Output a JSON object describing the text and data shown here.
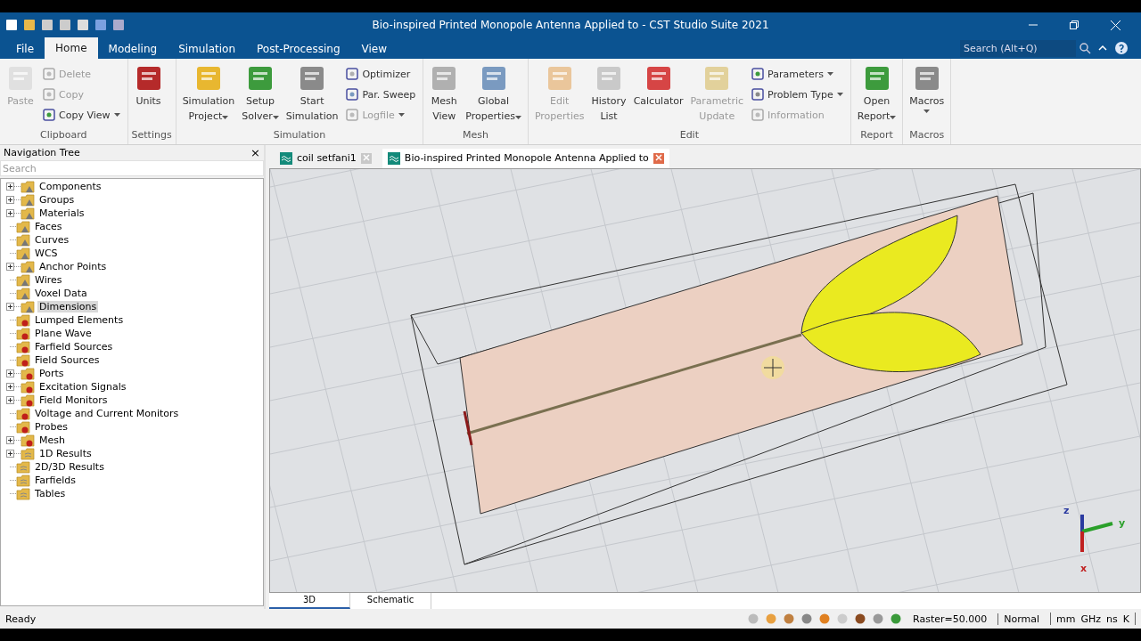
{
  "window": {
    "title": "Bio-inspired Printed Monopole Antenna Applied to - CST Studio Suite 2021"
  },
  "menu_tabs": [
    {
      "label": "File",
      "selected": false
    },
    {
      "label": "Home",
      "selected": true
    },
    {
      "label": "Modeling",
      "selected": false
    },
    {
      "label": "Simulation",
      "selected": false
    },
    {
      "label": "Post-Processing",
      "selected": false
    },
    {
      "label": "View",
      "selected": false
    }
  ],
  "search": {
    "placeholder": "Search (Alt+Q)"
  },
  "ribbon": [
    {
      "label": "Clipboard",
      "items": [
        {
          "kind": "large",
          "lines": [
            "Paste"
          ],
          "disabled": true,
          "dropdown": false
        },
        {
          "kind": "stack",
          "entries": [
            {
              "label": "Delete",
              "disabled": true,
              "dropdown": false
            },
            {
              "label": "Copy",
              "disabled": true,
              "dropdown": false
            },
            {
              "label": "Copy View",
              "disabled": false,
              "dropdown": true
            }
          ]
        }
      ]
    },
    {
      "label": "Settings",
      "items": [
        {
          "kind": "large",
          "lines": [
            "Units"
          ],
          "disabled": false,
          "dropdown": false
        }
      ]
    },
    {
      "label": "Simulation",
      "items": [
        {
          "kind": "large",
          "lines": [
            "Simulation",
            "Project"
          ],
          "disabled": false,
          "dropdown": true
        },
        {
          "kind": "large",
          "lines": [
            "Setup",
            "Solver"
          ],
          "disabled": false,
          "dropdown": true
        },
        {
          "kind": "large",
          "lines": [
            "Start",
            "Simulation"
          ],
          "disabled": false,
          "dropdown": false
        },
        {
          "kind": "stack",
          "entries": [
            {
              "label": "Optimizer",
              "disabled": false,
              "dropdown": false
            },
            {
              "label": "Par. Sweep",
              "disabled": false,
              "dropdown": false
            },
            {
              "label": "Logfile",
              "disabled": true,
              "dropdown": true
            }
          ]
        }
      ]
    },
    {
      "label": "Mesh",
      "items": [
        {
          "kind": "large",
          "lines": [
            "Mesh",
            "View"
          ],
          "disabled": false,
          "dropdown": false
        },
        {
          "kind": "large",
          "lines": [
            "Global",
            "Properties"
          ],
          "disabled": false,
          "dropdown": true
        }
      ]
    },
    {
      "label": "Edit",
      "items": [
        {
          "kind": "large",
          "lines": [
            "Edit",
            "Properties"
          ],
          "disabled": true,
          "dropdown": false
        },
        {
          "kind": "large",
          "lines": [
            "History",
            "List"
          ],
          "disabled": false,
          "dropdown": false
        },
        {
          "kind": "large",
          "lines": [
            "Calculator"
          ],
          "disabled": false,
          "dropdown": false
        },
        {
          "kind": "large",
          "lines": [
            "Parametric",
            "Update"
          ],
          "disabled": true,
          "dropdown": false
        },
        {
          "kind": "stack",
          "entries": [
            {
              "label": "Parameters",
              "disabled": false,
              "dropdown": true
            },
            {
              "label": "Problem Type",
              "disabled": false,
              "dropdown": true
            },
            {
              "label": "Information",
              "disabled": true,
              "dropdown": false
            }
          ]
        }
      ]
    },
    {
      "label": "Report",
      "items": [
        {
          "kind": "large",
          "lines": [
            "Open",
            "Report"
          ],
          "disabled": false,
          "dropdown": true
        }
      ]
    },
    {
      "label": "Macros",
      "items": [
        {
          "kind": "large",
          "lines": [
            "Macros"
          ],
          "disabled": false,
          "dropdown": true
        }
      ]
    }
  ],
  "navigation_tree": {
    "title": "Navigation Tree",
    "close": "×",
    "search": {
      "placeholder": "Search"
    },
    "items": [
      {
        "label": "Components",
        "kind": "folder",
        "expandable": true,
        "selected": false
      },
      {
        "label": "Groups",
        "kind": "folder",
        "expandable": true,
        "selected": false
      },
      {
        "label": "Materials",
        "kind": "folder",
        "expandable": true,
        "selected": false
      },
      {
        "label": "Faces",
        "kind": "folder",
        "expandable": false,
        "selected": false
      },
      {
        "label": "Curves",
        "kind": "folder",
        "expandable": false,
        "selected": false
      },
      {
        "label": "WCS",
        "kind": "folder",
        "expandable": false,
        "selected": false
      },
      {
        "label": "Anchor Points",
        "kind": "folder",
        "expandable": true,
        "selected": false
      },
      {
        "label": "Wires",
        "kind": "folder",
        "expandable": false,
        "selected": false
      },
      {
        "label": "Voxel Data",
        "kind": "folder",
        "expandable": false,
        "selected": false
      },
      {
        "label": "Dimensions",
        "kind": "folder",
        "expandable": true,
        "selected": true
      },
      {
        "label": "Lumped Elements",
        "kind": "source",
        "expandable": false,
        "selected": false
      },
      {
        "label": "Plane Wave",
        "kind": "source",
        "expandable": false,
        "selected": false
      },
      {
        "label": "Farfield Sources",
        "kind": "source",
        "expandable": false,
        "selected": false
      },
      {
        "label": "Field Sources",
        "kind": "source",
        "expandable": false,
        "selected": false
      },
      {
        "label": "Ports",
        "kind": "source",
        "expandable": true,
        "selected": false
      },
      {
        "label": "Excitation Signals",
        "kind": "source",
        "expandable": true,
        "selected": false
      },
      {
        "label": "Field Monitors",
        "kind": "source",
        "expandable": true,
        "selected": false
      },
      {
        "label": "Voltage and Current Monitors",
        "kind": "source",
        "expandable": false,
        "selected": false
      },
      {
        "label": "Probes",
        "kind": "source",
        "expandable": false,
        "selected": false
      },
      {
        "label": "Mesh",
        "kind": "source",
        "expandable": true,
        "selected": false
      },
      {
        "label": "1D Results",
        "kind": "result",
        "expandable": true,
        "selected": false
      },
      {
        "label": "2D/3D Results",
        "kind": "result",
        "expandable": false,
        "selected": false
      },
      {
        "label": "Farfields",
        "kind": "result",
        "expandable": false,
        "selected": false
      },
      {
        "label": "Tables",
        "kind": "result",
        "expandable": false,
        "selected": false
      }
    ]
  },
  "document_tabs": [
    {
      "label": "coil setfani1",
      "selected": false
    },
    {
      "label": "Bio-inspired Printed Monopole Antenna Applied to",
      "selected": true
    }
  ],
  "viewport": {
    "axes": [
      "z",
      "y",
      "x"
    ]
  },
  "view_tabs": [
    {
      "label": "3D",
      "selected": true
    },
    {
      "label": "Schematic",
      "selected": false
    }
  ],
  "status_bar": {
    "message": "Ready",
    "raster": "Raster=50.000",
    "mode": "Normal",
    "units": [
      "mm",
      "GHz",
      "ns",
      "K"
    ]
  }
}
